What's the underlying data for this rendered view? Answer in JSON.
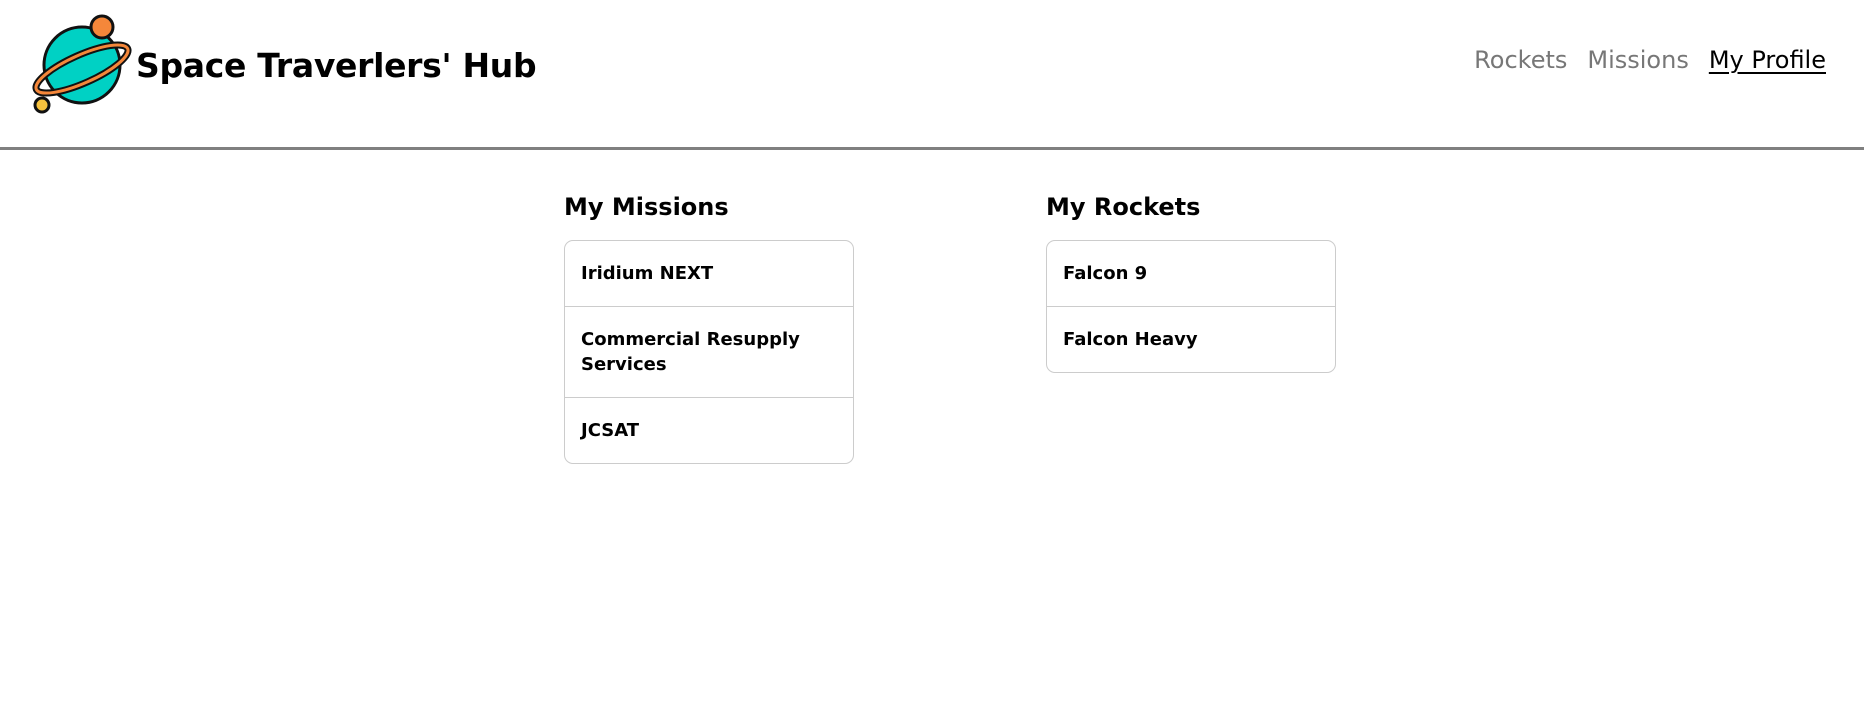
{
  "header": {
    "brand_title": "Space Traverlers' Hub",
    "logo_icon": "planet-logo-icon",
    "nav": [
      {
        "label": "Rockets",
        "active": false
      },
      {
        "label": "Missions",
        "active": false
      },
      {
        "label": "My Profile",
        "active": true
      }
    ]
  },
  "profile": {
    "missions": {
      "title": "My Missions",
      "items": [
        "Iridium NEXT",
        "Commercial Resupply Services",
        "JCSAT"
      ]
    },
    "rockets": {
      "title": "My Rockets",
      "items": [
        "Falcon 9",
        "Falcon Heavy"
      ]
    }
  },
  "colors": {
    "planet": "#00d1c4",
    "moon": "#f5873a",
    "small_moon": "#f7c23e",
    "divider": "#808080",
    "nav_inactive": "#777777"
  }
}
